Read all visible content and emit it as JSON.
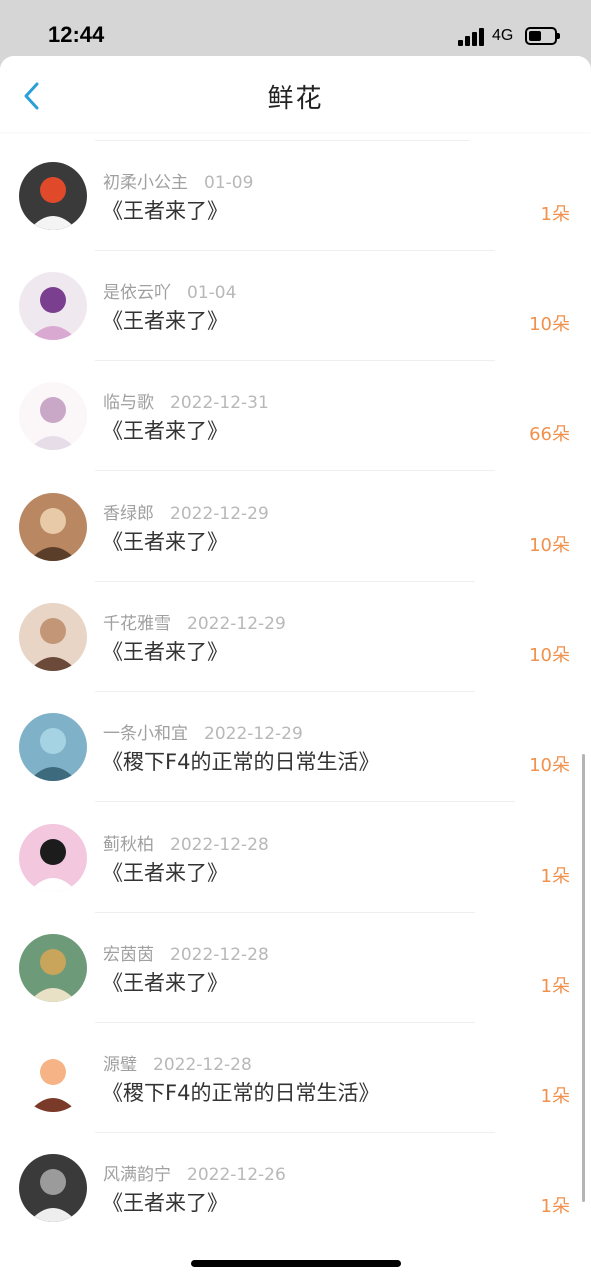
{
  "status_bar": {
    "time": "12:44",
    "network": "4G"
  },
  "header": {
    "title": "鲜花",
    "back_icon": "chevron-left-icon"
  },
  "colors": {
    "accent": "#2a9fd8",
    "count": "#f0914d"
  },
  "list": [
    {
      "user": "",
      "date": "",
      "book": "《王者来了》",
      "count": "1朵"
    },
    {
      "user": "初柔小公主",
      "date": "01-09",
      "book": "《王者来了》",
      "count": "1朵"
    },
    {
      "user": "是依云吖",
      "date": "01-04",
      "book": "《王者来了》",
      "count": "10朵"
    },
    {
      "user": "临与歌",
      "date": "2022-12-31",
      "book": "《王者来了》",
      "count": "66朵"
    },
    {
      "user": "香绿郎",
      "date": "2022-12-29",
      "book": "《王者来了》",
      "count": "10朵"
    },
    {
      "user": "千花雅雪",
      "date": "2022-12-29",
      "book": "《王者来了》",
      "count": "10朵"
    },
    {
      "user": "一条小和宜",
      "date": "2022-12-29",
      "book": "《稷下F4的正常的日常生活》",
      "count": "10朵"
    },
    {
      "user": "蓟秋柏",
      "date": "2022-12-28",
      "book": "《王者来了》",
      "count": "1朵"
    },
    {
      "user": "宏茵茵",
      "date": "2022-12-28",
      "book": "《王者来了》",
      "count": "1朵"
    },
    {
      "user": "源璧",
      "date": "2022-12-28",
      "book": "《稷下F4的正常的日常生活》",
      "count": "1朵"
    },
    {
      "user": "风满韵宁",
      "date": "2022-12-26",
      "book": "《王者来了》",
      "count": "1朵"
    }
  ]
}
